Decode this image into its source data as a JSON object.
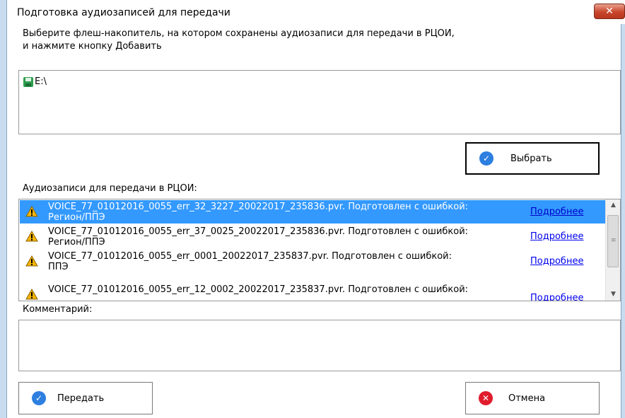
{
  "window": {
    "title": "Подготовка аудиозаписей для передачи",
    "close_glyph": "✕"
  },
  "instructions": {
    "line1": "Выберите флеш-накопитель, на котором сохранены аудиозаписи для передачи в РЦОИ,",
    "line2": "и нажмите кнопку Добавить"
  },
  "drives": [
    {
      "label": "E:\\",
      "icon": "floppy-disk-icon"
    }
  ],
  "select_button": {
    "label": "Выбрать",
    "icon": "checkmark-icon"
  },
  "records": {
    "label": "Аудиозаписи для передачи в РЦОИ:",
    "items": [
      {
        "line1": "VOICE_77_01012016_0055_err_32_3227_20022017_235836.pvr. Подготовлен с ошибкой:",
        "line2": "Регион/ППЭ",
        "link": "Подробнее",
        "selected": true
      },
      {
        "line1": "VOICE_77_01012016_0055_err_37_0025_20022017_235836.pvr. Подготовлен с ошибкой:",
        "line2": "Регион/ППЭ",
        "link": "Подробнее",
        "selected": false
      },
      {
        "line1": "VOICE_77_01012016_0055_err_0001_20022017_235837.pvr. Подготовлен с ошибкой:",
        "line2": "ППЭ",
        "link": "Подробнее",
        "selected": false
      },
      {
        "line1": "VOICE_77_01012016_0055_err_12_0002_20022017_235837.pvr. Подготовлен с ошибкой:",
        "line2": "",
        "link": "Подробнее",
        "selected": false
      }
    ]
  },
  "comment": {
    "label": "Комментарий:",
    "value": ""
  },
  "send_button": {
    "label": "Передать",
    "icon": "checkmark-icon"
  },
  "cancel_button": {
    "label": "Отмена",
    "icon": "cancel-x-icon"
  },
  "colors": {
    "selection": "#3399ff",
    "link": "#0000ee",
    "blue_icon": "#2d7fe0",
    "red_icon": "#e01c2c",
    "warning": "#f5b400"
  }
}
